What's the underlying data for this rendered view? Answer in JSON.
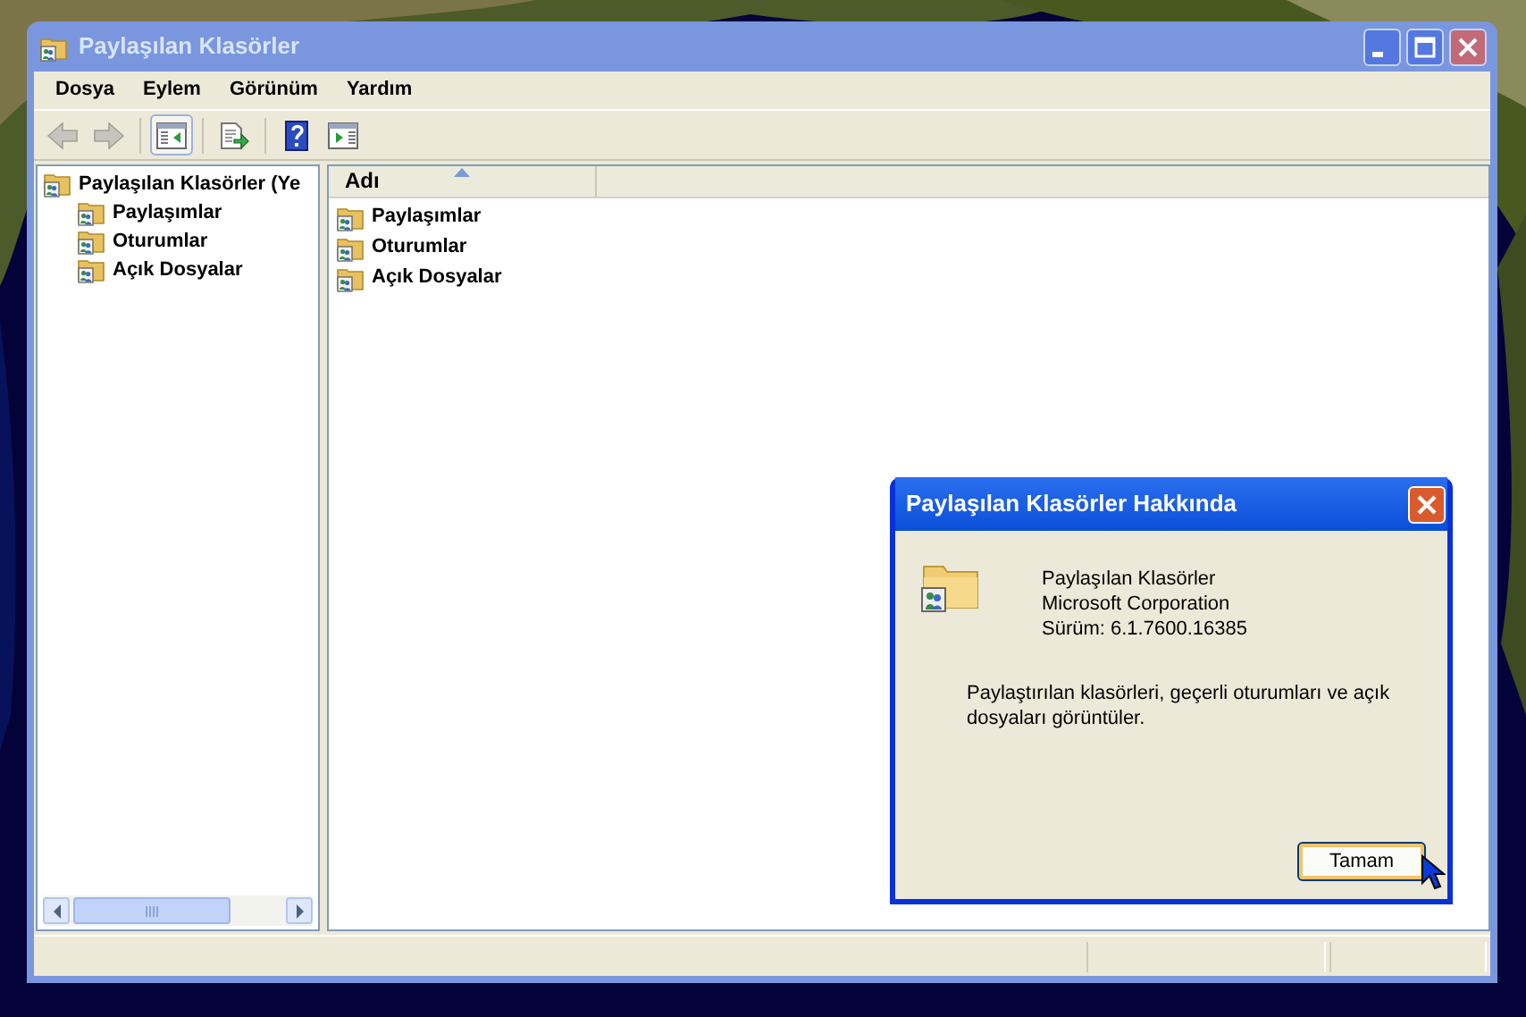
{
  "window": {
    "title": "Paylaşılan Klasörler"
  },
  "menu": [
    "Dosya",
    "Eylem",
    "Görünüm",
    "Yardım"
  ],
  "toolbar": [
    {
      "kind": "back",
      "disabled": true,
      "pressed": false
    },
    {
      "kind": "forward",
      "disabled": true,
      "pressed": false
    },
    {
      "kind": "tree",
      "disabled": false,
      "pressed": true
    },
    {
      "kind": "export",
      "disabled": false,
      "pressed": false
    },
    {
      "kind": "help",
      "disabled": false,
      "pressed": false
    },
    {
      "kind": "action",
      "disabled": false,
      "pressed": false
    }
  ],
  "tree": {
    "label": "Paylaşılan Klasörler (Ye",
    "children": [
      {
        "label": "Paylaşımlar"
      },
      {
        "label": "Oturumlar"
      },
      {
        "label": "Açık Dosyalar"
      }
    ]
  },
  "list": {
    "columns": [
      {
        "label": "Adı",
        "sort_ascending": true
      }
    ],
    "rows": [
      "Paylaşımlar",
      "Oturumlar",
      "Açık Dosyalar"
    ]
  },
  "dialog": {
    "title": "Paylaşılan Klasörler Hakkında",
    "info": [
      "Paylaşılan Klasörler",
      "Microsoft Corporation",
      "Sürüm: 6.1.7600.16385"
    ],
    "description": "Paylaştırılan klasörleri, geçerli oturumları ve açık dosyaları görüntüler.",
    "button": "Tamam"
  }
}
